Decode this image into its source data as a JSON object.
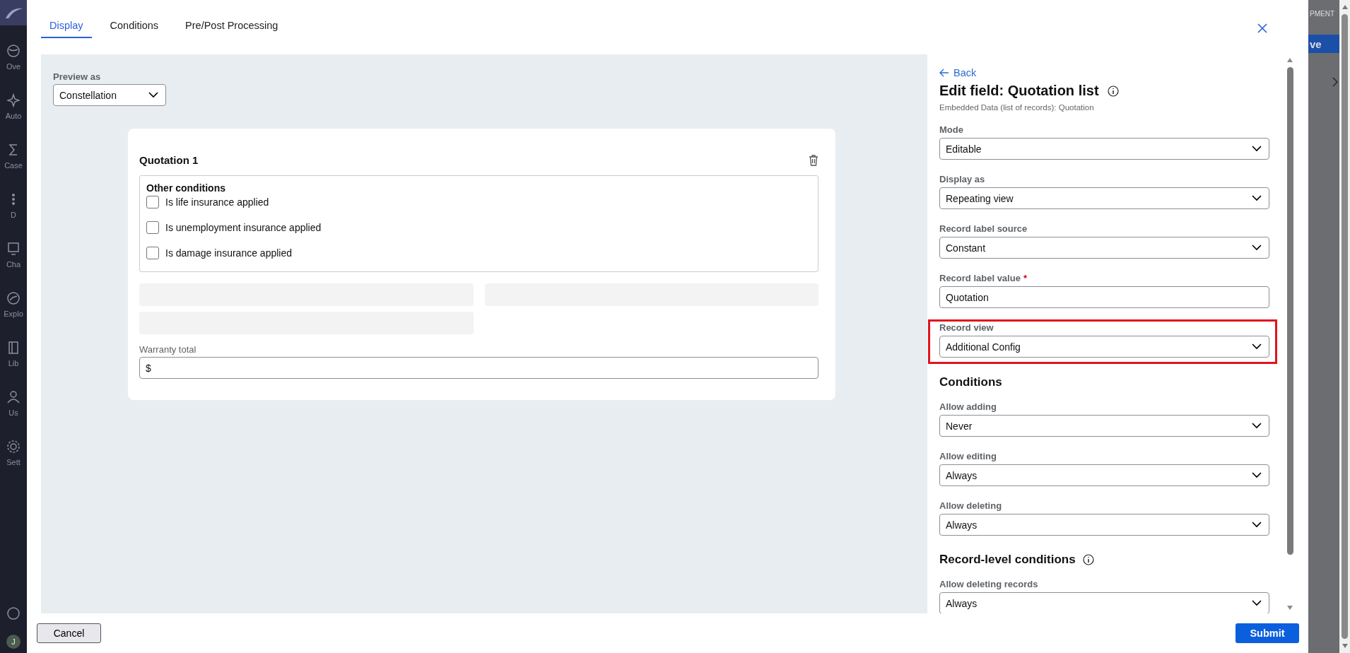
{
  "sidebar": {
    "items": [
      "Ove",
      "Auto",
      "Case",
      "D",
      "Cha",
      "Explo",
      "Lib",
      "Us",
      "Sett"
    ],
    "avatar": "J"
  },
  "background": {
    "header_text": "PMENT",
    "button": "ve"
  },
  "tabs": [
    {
      "label": "Display",
      "selected": true
    },
    {
      "label": "Conditions",
      "selected": false
    },
    {
      "label": "Pre/Post Processing",
      "selected": false
    }
  ],
  "preview": {
    "label": "Preview as",
    "value": "Constellation",
    "card": {
      "title": "Quotation 1",
      "group": {
        "title": "Other conditions",
        "options": [
          {
            "label": "Is life insurance applied",
            "checked": false
          },
          {
            "label": "Is unemployment insurance applied",
            "checked": false
          },
          {
            "label": "Is damage insurance applied",
            "checked": false
          }
        ]
      },
      "field": {
        "label": "Warranty total",
        "value": "$"
      }
    }
  },
  "panel": {
    "back": "Back",
    "title": "Edit field: Quotation list",
    "subtitle": "Embedded Data (list of records): Quotation",
    "items": [
      {
        "kind": "select",
        "label": "Mode",
        "value": "Editable"
      },
      {
        "kind": "select",
        "label": "Display as",
        "value": "Repeating view"
      },
      {
        "kind": "select",
        "label": "Record label source",
        "value": "Constant"
      },
      {
        "kind": "input",
        "label": "Record label value",
        "value": "Quotation",
        "required_mark": "*"
      },
      {
        "kind": "select",
        "label": "Record view",
        "value": "Additional Config",
        "highlighted": true
      },
      {
        "kind": "heading",
        "label": "Conditions"
      },
      {
        "kind": "select",
        "label": "Allow adding",
        "value": "Never"
      },
      {
        "kind": "select",
        "label": "Allow editing",
        "value": "Always"
      },
      {
        "kind": "select",
        "label": "Allow deleting",
        "value": "Always"
      },
      {
        "kind": "heading",
        "label": "Record-level conditions",
        "info": true
      },
      {
        "kind": "select",
        "label": "Allow deleting records",
        "value": "Always"
      }
    ]
  },
  "buttons": {
    "cancel": "Cancel",
    "submit": "Submit"
  }
}
